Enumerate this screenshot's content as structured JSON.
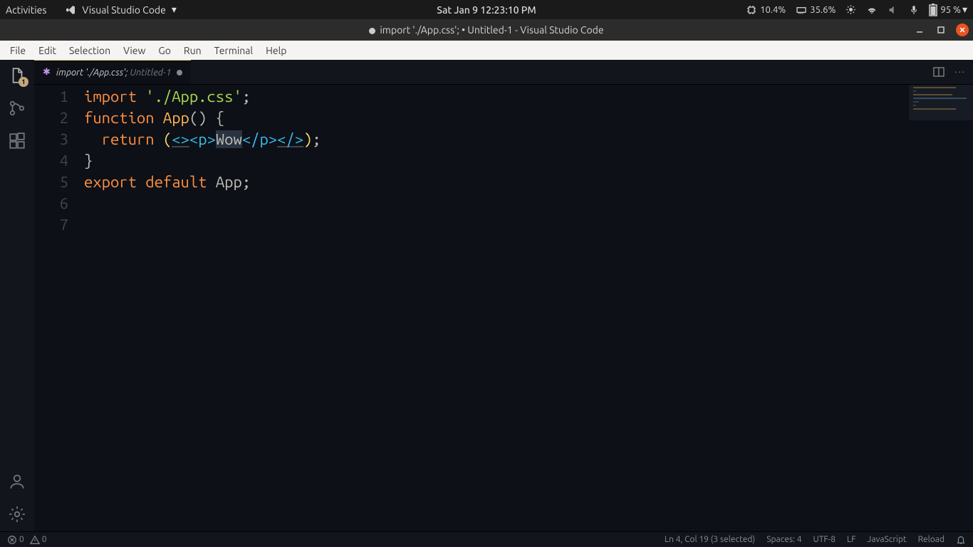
{
  "gnome": {
    "activities": "Activities",
    "app_name": "Visual Studio Code",
    "datetime": "Sat Jan 9  12:23:10 PM",
    "cpu_pct": "10.4%",
    "mem_pct": "35.6%",
    "battery_pct": "95 %"
  },
  "titlebar": {
    "title": "import './App.css'; • Untitled-1 - Visual Studio Code"
  },
  "menubar": [
    "File",
    "Edit",
    "Selection",
    "View",
    "Go",
    "Run",
    "Terminal",
    "Help"
  ],
  "activitybar": {
    "explorer_badge": "1"
  },
  "tab": {
    "icon": "✱",
    "label_main": "import './App.css';",
    "label_dim": "Untitled-1"
  },
  "code": {
    "line1": {
      "kw": "import",
      "str": "'./App.css'",
      "end": ";"
    },
    "line2": "",
    "line3": {
      "kw": "function",
      "name": "App",
      "parens": "()",
      "brace": "{"
    },
    "line4": {
      "indent": "  ",
      "kw": "return",
      "open_y": "(",
      "frag_open": "<>",
      "p_open_lt": "<",
      "p_open_name": "p",
      "p_open_gt": ">",
      "text": "Wow",
      "p_close_lt": "</",
      "p_close_name": "p",
      "p_close_gt": ">",
      "frag_close": "</>",
      "close_y": ")",
      "semi": ";"
    },
    "line5": {
      "brace": "}"
    },
    "line6": "",
    "line7": {
      "kw1": "export",
      "kw2": "default",
      "ident": "App",
      "semi": ";"
    }
  },
  "line_numbers": [
    "1",
    "2",
    "3",
    "4",
    "5",
    "6",
    "7"
  ],
  "statusbar": {
    "errors": "0",
    "warnings": "0",
    "cursor": "Ln 4, Col 19 (3 selected)",
    "spaces": "Spaces: 4",
    "encoding": "UTF-8",
    "eol": "LF",
    "language": "JavaScript",
    "reload": "Reload"
  }
}
